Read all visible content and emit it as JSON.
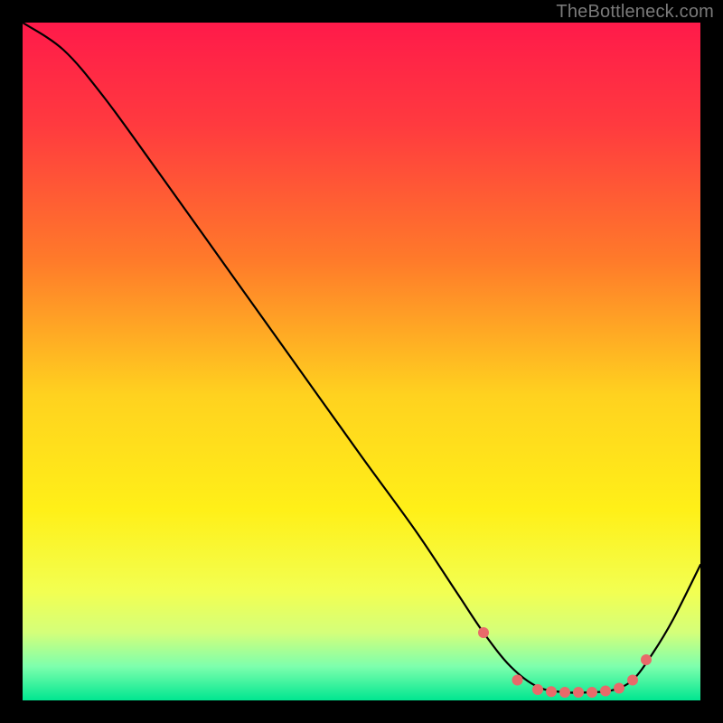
{
  "attribution": "TheBottleneck.com",
  "chart_data": {
    "type": "line",
    "title": "",
    "xlabel": "",
    "ylabel": "",
    "xlim": [
      0,
      100
    ],
    "ylim": [
      0,
      100
    ],
    "background_gradient_stops": [
      {
        "pos": 0.0,
        "color": "#ff1a4a"
      },
      {
        "pos": 0.15,
        "color": "#ff3a3f"
      },
      {
        "pos": 0.35,
        "color": "#ff7a2a"
      },
      {
        "pos": 0.55,
        "color": "#ffd21f"
      },
      {
        "pos": 0.72,
        "color": "#fff018"
      },
      {
        "pos": 0.84,
        "color": "#f2ff52"
      },
      {
        "pos": 0.9,
        "color": "#d4ff7a"
      },
      {
        "pos": 0.95,
        "color": "#7dffad"
      },
      {
        "pos": 1.0,
        "color": "#00e690"
      }
    ],
    "curve": {
      "x": [
        0,
        6,
        12,
        20,
        30,
        40,
        50,
        58,
        64,
        68,
        72,
        76,
        80,
        84,
        87,
        90,
        93,
        96,
        100
      ],
      "y": [
        100,
        96,
        89,
        78,
        64,
        50,
        36,
        25,
        16,
        10,
        5,
        2,
        1.2,
        1.2,
        1.5,
        3,
        7,
        12,
        20
      ]
    },
    "markers": {
      "x": [
        68,
        73,
        76,
        78,
        80,
        82,
        84,
        86,
        88,
        90,
        92
      ],
      "y": [
        10,
        3,
        1.6,
        1.3,
        1.2,
        1.2,
        1.2,
        1.4,
        1.8,
        3,
        6
      ],
      "color": "#e86a6a",
      "radius_px": 6
    }
  }
}
